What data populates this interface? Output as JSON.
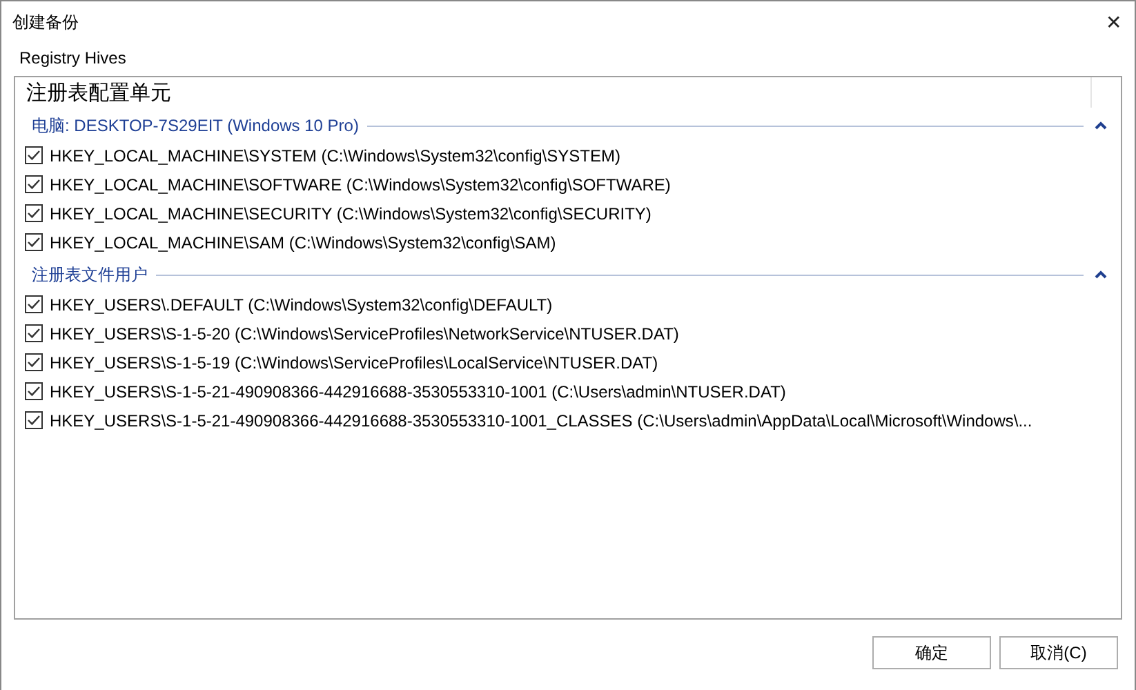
{
  "window": {
    "title": "创建备份",
    "close": "✕"
  },
  "section_label": "Registry Hives",
  "list": {
    "column_header": "注册表配置单元",
    "groups": [
      {
        "title": "电脑: DESKTOP-7S29EIT (Windows 10 Pro)",
        "expanded": true,
        "items": [
          {
            "label": "HKEY_LOCAL_MACHINE\\SYSTEM (C:\\Windows\\System32\\config\\SYSTEM)",
            "checked": true
          },
          {
            "label": "HKEY_LOCAL_MACHINE\\SOFTWARE (C:\\Windows\\System32\\config\\SOFTWARE)",
            "checked": true
          },
          {
            "label": "HKEY_LOCAL_MACHINE\\SECURITY (C:\\Windows\\System32\\config\\SECURITY)",
            "checked": true
          },
          {
            "label": "HKEY_LOCAL_MACHINE\\SAM (C:\\Windows\\System32\\config\\SAM)",
            "checked": true
          }
        ]
      },
      {
        "title": "注册表文件用户",
        "expanded": true,
        "items": [
          {
            "label": "HKEY_USERS\\.DEFAULT (C:\\Windows\\System32\\config\\DEFAULT)",
            "checked": true
          },
          {
            "label": "HKEY_USERS\\S-1-5-20 (C:\\Windows\\ServiceProfiles\\NetworkService\\NTUSER.DAT)",
            "checked": true
          },
          {
            "label": "HKEY_USERS\\S-1-5-19 (C:\\Windows\\ServiceProfiles\\LocalService\\NTUSER.DAT)",
            "checked": true
          },
          {
            "label": "HKEY_USERS\\S-1-5-21-490908366-442916688-3530553310-1001 (C:\\Users\\admin\\NTUSER.DAT)",
            "checked": true
          },
          {
            "label": "HKEY_USERS\\S-1-5-21-490908366-442916688-3530553310-1001_CLASSES (C:\\Users\\admin\\AppData\\Local\\Microsoft\\Windows\\...",
            "checked": true
          }
        ]
      }
    ]
  },
  "buttons": [
    "确定",
    "取消(C)"
  ]
}
